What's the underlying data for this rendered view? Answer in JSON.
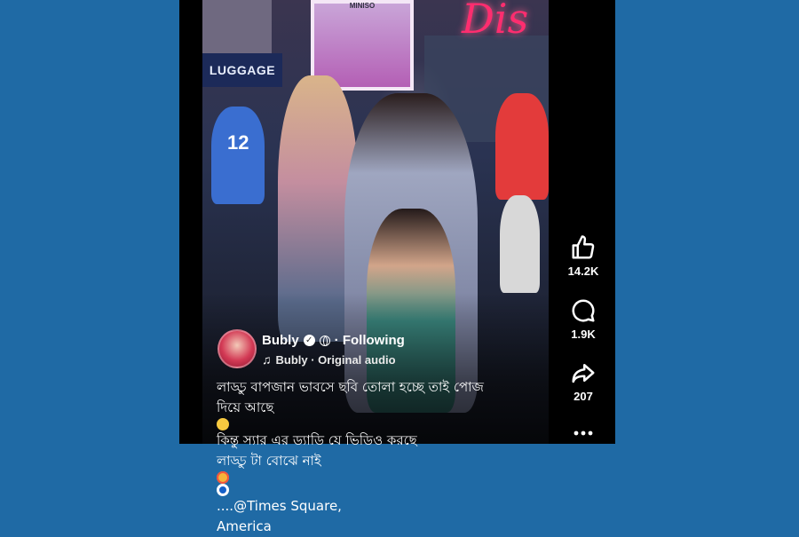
{
  "video": {
    "sign_luggage": "LUGGAGE",
    "billboard_label": "MINISO",
    "storefront_text": "Dis",
    "jersey_number": "12"
  },
  "post": {
    "author": "Bubly",
    "follow_status": "· Following",
    "audio": "Bubly · Original audio",
    "caption_lines": [
      "লাড্ডু বাপজান ভাবসে ছবি তোলা হচ্ছে তাই পোজ",
      "দিয়ে আছে",
      "কিন্তু স্যার এর ড্যাডি যে ভিডিও করছে",
      "লাড্ডু টা বোঝে নাই",
      "....@Times Square,",
      "America"
    ]
  },
  "actions": {
    "likes": "14.2K",
    "comments": "1.9K",
    "shares": "207"
  },
  "colors": {
    "background": "#1f6aa5",
    "panel": "#000000"
  }
}
